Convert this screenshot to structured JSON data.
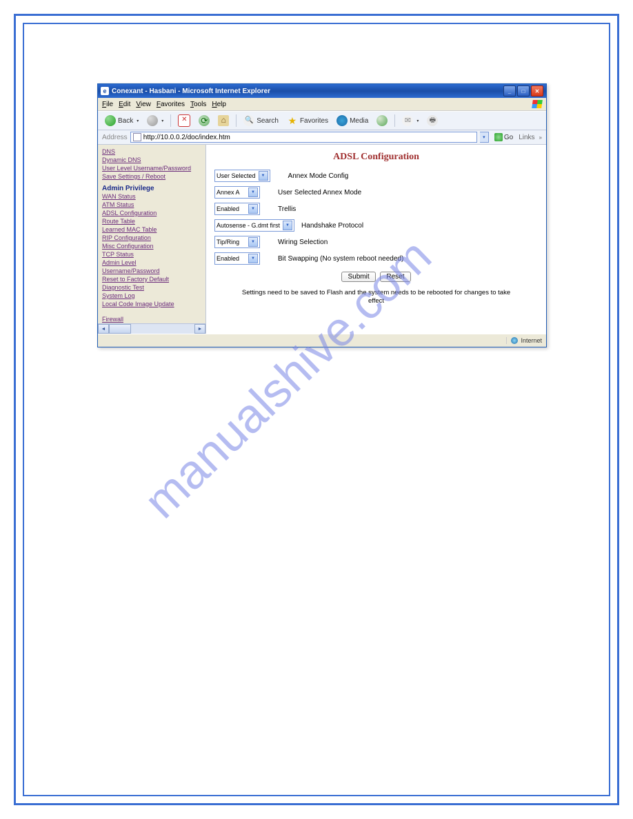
{
  "watermark": "manualshive.com",
  "window": {
    "title": "Conexant - Hasbani - Microsoft Internet Explorer"
  },
  "menu": {
    "file": "File",
    "edit": "Edit",
    "view": "View",
    "favorites": "Favorites",
    "tools": "Tools",
    "help": "Help"
  },
  "toolbar": {
    "back": "Back",
    "search": "Search",
    "favorites": "Favorites",
    "media": "Media"
  },
  "address": {
    "label": "Address",
    "url": "http://10.0.0.2/doc/index.htm",
    "go": "Go",
    "links": "Links"
  },
  "sidebar": {
    "top_links": [
      "DNS",
      "Dynamic DNS",
      "User Level Username/Password",
      "Save Settings / Reboot"
    ],
    "heading": "Admin Privilege",
    "admin_links": [
      "WAN Status",
      "ATM Status",
      "ADSL Configuration",
      "Route Table",
      "Learned MAC Table",
      "RIP Configuration",
      "Misc Configuration",
      "TCP Status",
      "Admin Level",
      "Username/Password",
      "Reset to Factory Default",
      "Diagnostic Test",
      "System Log",
      "Local Code Image Update"
    ],
    "firewall": "Firewall"
  },
  "content": {
    "title": "ADSL Configuration",
    "rows": [
      {
        "select": "User Selected",
        "label": "Annex Mode Config"
      },
      {
        "select": "Annex A",
        "label": "User Selected Annex Mode"
      },
      {
        "select": "Enabled",
        "label": "Trellis"
      },
      {
        "select": "Autosense - G.dmt first",
        "label": "Handshake Protocol",
        "wide": true
      },
      {
        "select": "Tip/Ring",
        "label": "Wiring Selection"
      },
      {
        "select": "Enabled",
        "label": "Bit Swapping (No system reboot needed)"
      }
    ],
    "submit": "Submit",
    "reset": "Reset",
    "note1": "Settings need to be saved to Flash and the system needs to be rebooted for changes to take",
    "note2": "effect"
  },
  "status": {
    "zone": "Internet"
  }
}
